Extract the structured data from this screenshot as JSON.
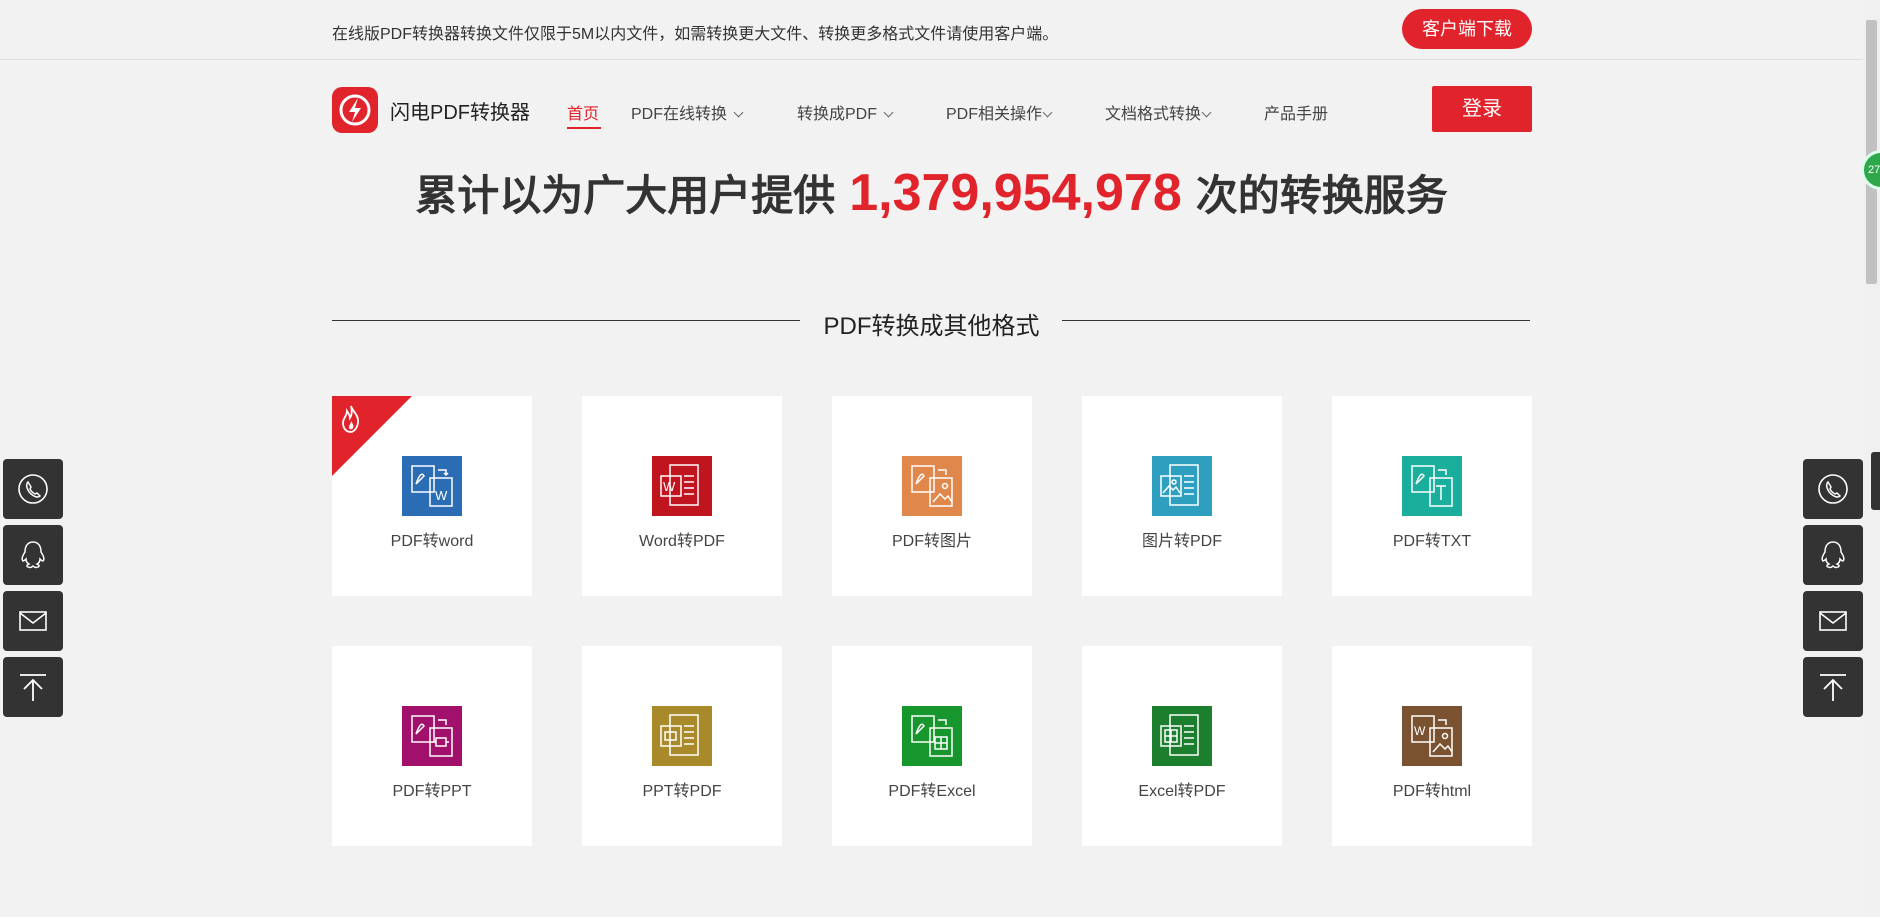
{
  "notice_bar": {
    "text": "在线版PDF转换器转换文件仅限于5M以内文件，如需转换更大文件、转换更多格式文件请使用客户端。",
    "download_label": "客户端下载"
  },
  "header": {
    "logo_text": "闪电PDF转换器",
    "nav": [
      {
        "label": "首页",
        "active": true,
        "dropdown": false
      },
      {
        "label": "PDF在线转换",
        "active": false,
        "dropdown": true
      },
      {
        "label": "转换成PDF",
        "active": false,
        "dropdown": true
      },
      {
        "label": "PDF相关操作",
        "active": false,
        "dropdown": true
      },
      {
        "label": "文档格式转换",
        "active": false,
        "dropdown": true
      },
      {
        "label": "产品手册",
        "active": false,
        "dropdown": false
      }
    ],
    "login_label": "登录"
  },
  "stats": {
    "prefix": "累计以为广大用户提供",
    "count": "1,379,954,978",
    "suffix": "次的转换服务"
  },
  "section": {
    "title": "PDF转换成其他格式"
  },
  "tools": [
    {
      "label": "PDF转word",
      "color": "#2a6db5",
      "icon": "pdf-to-word-icon",
      "hot": true
    },
    {
      "label": "Word转PDF",
      "color": "#c0151f",
      "icon": "word-to-pdf-icon",
      "hot": false
    },
    {
      "label": "PDF转图片",
      "color": "#e0874c",
      "icon": "pdf-to-image-icon",
      "hot": false
    },
    {
      "label": "图片转PDF",
      "color": "#2e9fbf",
      "icon": "image-to-pdf-icon",
      "hot": false
    },
    {
      "label": "PDF转TXT",
      "color": "#1aae9c",
      "icon": "pdf-to-txt-icon",
      "hot": false
    },
    {
      "label": "PDF转PPT",
      "color": "#a1116c",
      "icon": "pdf-to-ppt-icon",
      "hot": false
    },
    {
      "label": "PPT转PDF",
      "color": "#a88a2a",
      "icon": "ppt-to-pdf-icon",
      "hot": false
    },
    {
      "label": "PDF转Excel",
      "color": "#17962d",
      "icon": "pdf-to-excel-icon",
      "hot": false
    },
    {
      "label": "Excel转PDF",
      "color": "#1b7f2e",
      "icon": "excel-to-pdf-icon",
      "hot": false
    },
    {
      "label": "PDF转html",
      "color": "#7a5230",
      "icon": "pdf-to-html-icon",
      "hot": false
    }
  ],
  "side_buttons": [
    "phone-icon",
    "qq-icon",
    "mail-icon",
    "back-to-top-icon"
  ],
  "colors": {
    "brand": "#e1232b",
    "background": "#f2f2f2",
    "side_button": "#333333"
  }
}
